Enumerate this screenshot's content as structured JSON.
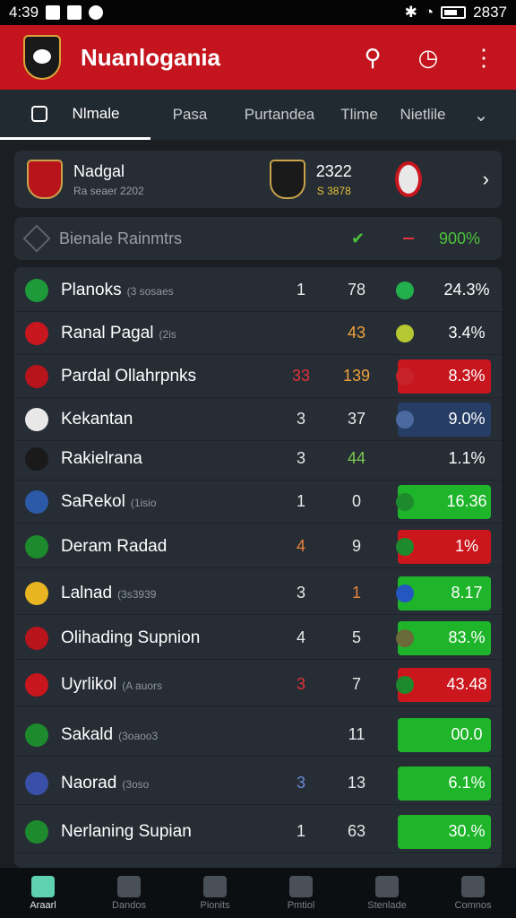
{
  "status_bar": {
    "time": "4:39",
    "battery": "2837"
  },
  "app": {
    "title": "Nuanlogania"
  },
  "tabs": [
    {
      "label": "Nlmale"
    },
    {
      "label": "Pasa"
    },
    {
      "label": "Purtandea"
    },
    {
      "label": "Tlime"
    },
    {
      "label": "Nietlile"
    }
  ],
  "match": {
    "team_name": "Nadgal",
    "subtitle": "Ra seaer 2202",
    "score_main": "2322",
    "score_minor": "S 3878"
  },
  "summary": {
    "label": "Bienale Rainmtrs",
    "value": "900%"
  },
  "rows": [
    {
      "team": "Planoks",
      "sub": "(3 sosaes",
      "c1": "1",
      "c2": "78",
      "pct": "24.3%",
      "c1_color": "#e8e8e8",
      "c2_color": "#e8e8e8",
      "dot": "#22b04c",
      "pill": ""
    },
    {
      "team": "Ranal Pagal",
      "sub": "(2is",
      "c1": "",
      "c2": "43",
      "pct": "3.4%",
      "c1_color": "#e8e8e8",
      "c2_color": "#f2a13a",
      "dot": "#b5c832",
      "pill": ""
    },
    {
      "team": "Pardal Ollahrpnks",
      "sub": "",
      "c1": "33",
      "c2": "139",
      "pct": "8.3%",
      "c1_color": "#e2333b",
      "c2_color": "#f2a13a",
      "dot": "#c8222a",
      "pill": "#c8161f"
    },
    {
      "team": "Kekantan",
      "sub": "",
      "c1": "3",
      "c2": "37",
      "pct": "9.0%",
      "c1_color": "#e8e8e8",
      "c2_color": "#e8e8e8",
      "dot": "#4a6aa0",
      "pill": "#263d66"
    },
    {
      "team": "Rakielrana",
      "sub": "",
      "c1": "3",
      "c2": "44",
      "pct": "1.1%",
      "c1_color": "#e8e8e8",
      "c2_color": "#7ec850",
      "dot": "",
      "pill": ""
    },
    {
      "team": "SaRekol",
      "sub": "(1isio",
      "c1": "1",
      "c2": "0",
      "pct": "16.36",
      "c1_color": "#e8e8e8",
      "c2_color": "#e8e8e8",
      "dot": "#1e8a2e",
      "pill": "#1fb52a"
    },
    {
      "team": "Deram Radad",
      "sub": "",
      "c1": "4",
      "c2": "9",
      "pct": "1%",
      "c1_color": "#e8823a",
      "c2_color": "#e8e8e8",
      "dot": "#1e8a2e",
      "pill": "#cc161d"
    },
    {
      "team": "Lalnad",
      "sub": "(3s3939",
      "c1": "3",
      "c2": "1",
      "pct": "8.17",
      "c1_color": "#e8e8e8",
      "c2_color": "#e8823a",
      "dot": "#2457c0",
      "pill": "#1fb52a"
    },
    {
      "team": "Olihading Supnion",
      "sub": "",
      "c1": "4",
      "c2": "5",
      "pct": "83.%",
      "c1_color": "#e8e8e8",
      "c2_color": "#e8e8e8",
      "dot": "#6a6a3a",
      "pill": "#1fb52a"
    },
    {
      "team": "Uyrlikol",
      "sub": "(A auors",
      "c1": "3",
      "c2": "7",
      "pct": "43.48",
      "c1_color": "#e2333b",
      "c2_color": "#e8e8e8",
      "dot": "#1e8a2e",
      "pill": "#cc161d"
    },
    {
      "team": "Sakald",
      "sub": "(3oaoo3",
      "c1": "",
      "c2": "11",
      "pct": "00.0",
      "c1_color": "#e8e8e8",
      "c2_color": "#e8e8e8",
      "dot": "",
      "pill": "#1fb52a"
    },
    {
      "team": "Naorad",
      "sub": "(3oso",
      "c1": "3",
      "c2": "13",
      "pct": "6.1%",
      "c1_color": "#6a8ad8",
      "c2_color": "#e8e8e8",
      "dot": "",
      "pill": "#1fb52a"
    },
    {
      "team": "Nerlaning Supian",
      "sub": "",
      "c1": "1",
      "c2": "63",
      "pct": "30.%",
      "c1_color": "#e8e8e8",
      "c2_color": "#e8e8e8",
      "dot": "",
      "pill": "#1fb52a"
    }
  ],
  "bottom_nav": [
    {
      "label": "Araarl"
    },
    {
      "label": "Dandos"
    },
    {
      "label": "Pionits"
    },
    {
      "label": "Pmtiol"
    },
    {
      "label": "Stenlade"
    },
    {
      "label": "Comnos"
    }
  ],
  "colors": {
    "brand": "#c4141d",
    "accent_green": "#1fb52a",
    "accent_red": "#cc161d"
  },
  "icons": [
    "search-icon",
    "clock-icon",
    "more-vert-icon",
    "chevron-right-icon",
    "chevron-down-icon",
    "home-icon"
  ]
}
